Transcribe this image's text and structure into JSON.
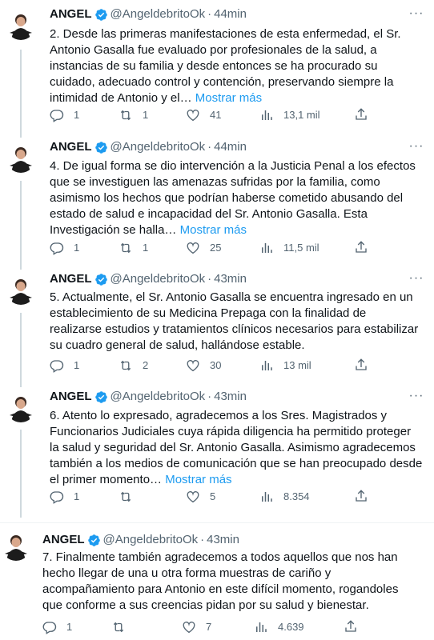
{
  "tweets": [
    {
      "name": "ANGEL",
      "handle": "@AngeldebritoOk",
      "dot": "·",
      "time": "44min",
      "text": "2. Desde las primeras manifestaciones de esta enfermedad, el Sr. Antonio Gasalla fue evaluado por profesionales de la salud, a instancias de su familia y desde entonces se ha procurado su cuidado, adecuado control y contención, preservando siempre la intimidad de Antonio y el…",
      "show_more": "Mostrar más",
      "replies": "1",
      "retweets": "1",
      "likes": "41",
      "views": "13,1 mil"
    },
    {
      "name": "ANGEL",
      "handle": "@AngeldebritoOk",
      "dot": "·",
      "time": "44min",
      "text": "4. De igual forma se dio intervención a la Justicia Penal a los efectos que se investiguen las amenazas sufridas por la familia, como asimismo los hechos que podrían haberse cometido abusando del estado de salud e incapacidad del Sr. Antonio Gasalla. Esta Investigación se halla…",
      "show_more": "Mostrar más",
      "replies": "1",
      "retweets": "1",
      "likes": "25",
      "views": "11,5 mil"
    },
    {
      "name": "ANGEL",
      "handle": "@AngeldebritoOk",
      "dot": "·",
      "time": "43min",
      "text": "5. Actualmente, el Sr. Antonio Gasalla se encuentra ingresado en un establecimiento de su Medicina Prepaga con la finalidad de realizarse estudios y tratamientos clínicos necesarios para estabilizar su cuadro general de salud, hallándose estable.",
      "show_more": "",
      "replies": "1",
      "retweets": "2",
      "likes": "30",
      "views": "13 mil"
    },
    {
      "name": "ANGEL",
      "handle": "@AngeldebritoOk",
      "dot": "·",
      "time": "43min",
      "text": "6. Atento lo expresado, agradecemos a los Sres. Magistrados y Funcionarios Judiciales cuya rápida diligencia ha permitido proteger la salud y seguridad del Sr. Antonio Gasalla. Asimismo agradecemos también a los medios de comunicación que se han preocupado desde el primer momento…",
      "show_more": "Mostrar más",
      "replies": "1",
      "retweets": "",
      "likes": "5",
      "views": "8.354"
    },
    {
      "name": "ANGEL",
      "handle": "@AngeldebritoOk",
      "dot": "·",
      "time": "43min",
      "text": "7. Finalmente también agradecemos a todos aquellos que nos han hecho llegar de una u otra forma muestras de cariño y acompañamiento para Antonio en este difícil momento, rogandoles que conforme a sus creencias pidan por su salud y bienestar.",
      "show_more": "",
      "replies": "1",
      "retweets": "",
      "likes": "7",
      "views": "4.639"
    }
  ],
  "more_icon": "···",
  "colors": {
    "link": "#1d9bf0",
    "muted": "#536471",
    "text": "#0f1419",
    "verified": "#1d9bf0"
  }
}
